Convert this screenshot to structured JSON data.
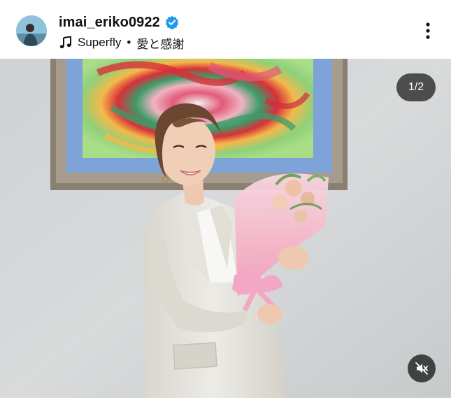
{
  "post": {
    "username": "imai_eriko0922",
    "verified": true,
    "music": {
      "artist": "Superfly",
      "separator": "•",
      "title": "愛と感謝"
    },
    "carousel_counter": "1/2",
    "icons": {
      "verified": "verified-badge-icon",
      "music": "music-note-icon",
      "more": "more-options-icon",
      "mute": "speaker-muted-icon"
    },
    "colors": {
      "verified_blue": "#1d9bf0",
      "counter_bg": "#2d2d2d"
    }
  }
}
